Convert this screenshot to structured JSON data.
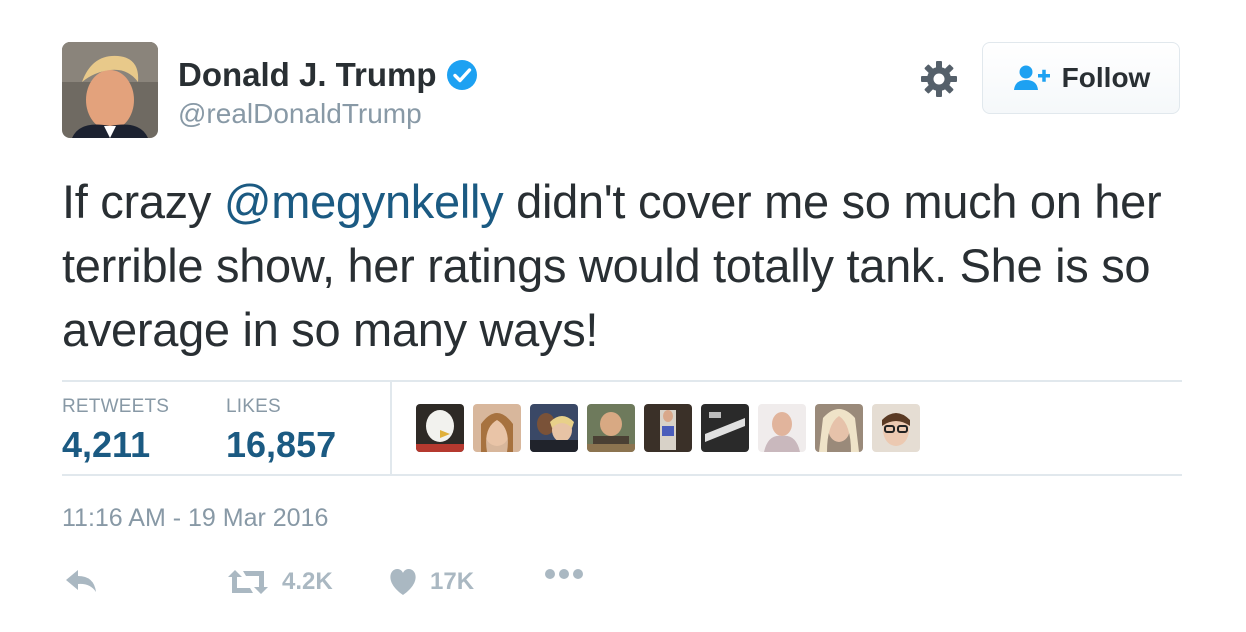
{
  "header": {
    "name": "Donald J. Trump",
    "handle": "@realDonaldTrump",
    "follow_label": "Follow"
  },
  "tweet": {
    "text_before": "If crazy ",
    "mention": "@megynkelly",
    "text_after": " didn't cover me so much on her terrible show, her ratings would totally tank. She is so average in so many ways!"
  },
  "stats": {
    "retweets_label": "RETWEETS",
    "retweets_value": "4,211",
    "likes_label": "LIKES",
    "likes_value": "16,857"
  },
  "timestamp": "11:16 AM - 19 Mar 2016",
  "actions": {
    "retweet_count": "4.2K",
    "like_count": "17K"
  },
  "colors": {
    "link": "#1b5a82",
    "verified": "#1da1f2",
    "muted": "#8899a6"
  }
}
